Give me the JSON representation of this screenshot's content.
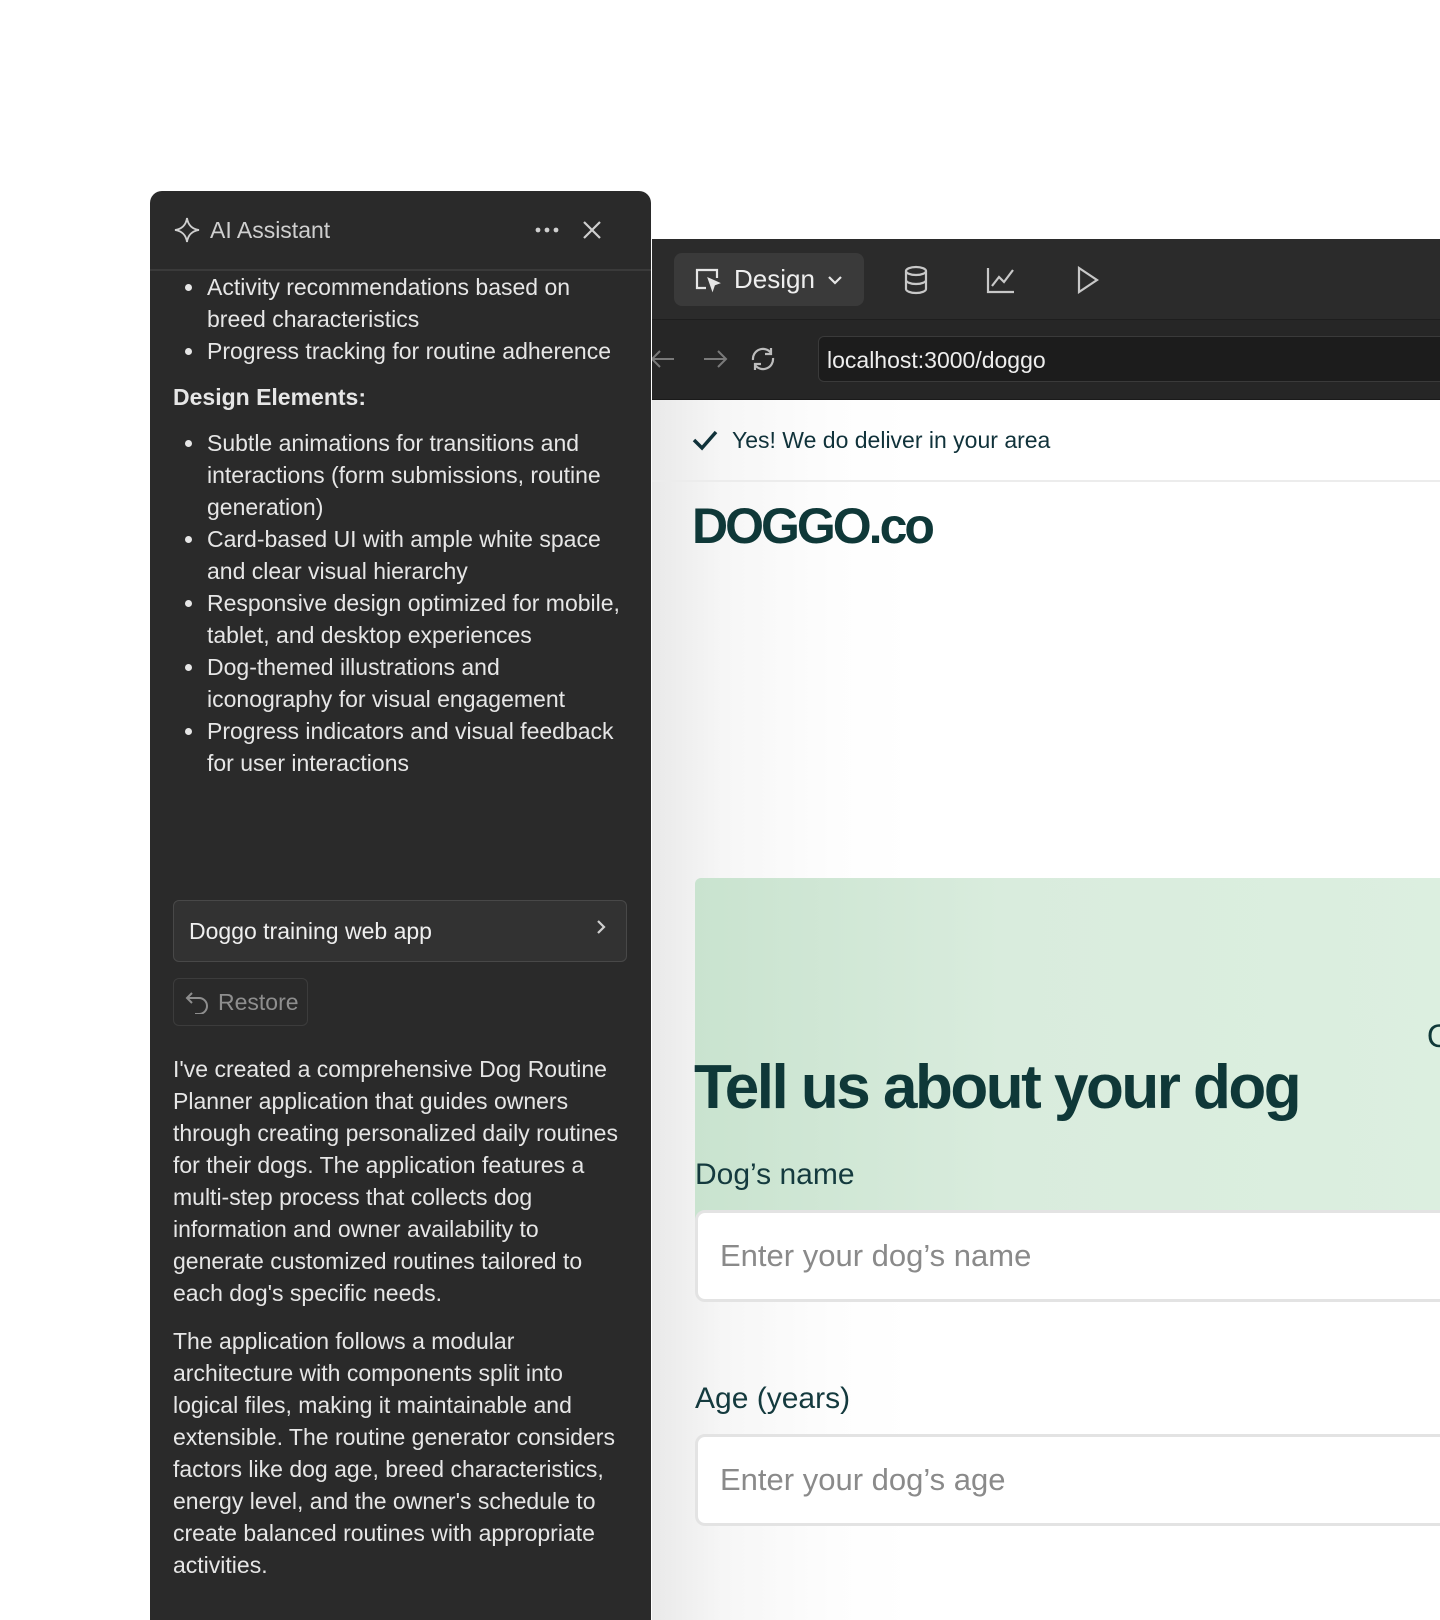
{
  "assistant": {
    "title": "AI Assistant",
    "icons": {
      "title": "sparkle-icon",
      "more": "more-horizontal-icon",
      "close": "close-icon"
    },
    "bullets_top": [
      "Activity recommendations based on breed characteristics",
      "Progress tracking for routine adherence"
    ],
    "design_heading": "Design Elements:",
    "design_bullets": [
      "Subtle animations for transitions and interactions (form submissions, routine generation)",
      "Card-based UI with ample white space and clear visual hierarchy",
      "Responsive design optimized for mobile, tablet, and desktop experiences",
      "Dog-themed illustrations and iconography for visual engagement",
      "Progress indicators and visual feedback for user interactions"
    ],
    "project_card": "Doggo training web app",
    "restore_label": "Restore",
    "summary_paragraphs": [
      "I've created a comprehensive Dog Routine Planner application that guides owners through creating personalized daily routines for their dogs. The application features a multi-step process that collects dog information and owner availability to generate customized routines tailored to each dog's specific needs.",
      "The application follows a modular architecture with components split into logical files, making it maintainable and extensible. The routine generator considers factors like dog age, breed characteristics, energy level, and the owner's schedule to create balanced routines with appropriate activities."
    ]
  },
  "browser": {
    "mode_label": "Design",
    "toolbar_icons": [
      "cursor-select-icon",
      "database-icon",
      "chart-icon",
      "play-icon"
    ],
    "nav_icons": [
      "back-arrow-icon",
      "forward-arrow-icon",
      "refresh-icon"
    ],
    "url": "localhost:3000/doggo"
  },
  "site": {
    "delivery_message": "Yes! We do deliver in your area",
    "logo": "DOGGO.co",
    "hero_partial_text": "C",
    "heading": "Tell us about your dog",
    "name_label": "Dog’s name",
    "name_placeholder": "Enter your dog’s name",
    "age_label": "Age (years)",
    "age_placeholder": "Enter your dog’s age"
  },
  "colors": {
    "panel_bg": "#2a2a2a",
    "toolbar_bg": "#2b2b2b",
    "brand_dark_green": "#0f3838",
    "hero_green": "#d9ecdd"
  }
}
